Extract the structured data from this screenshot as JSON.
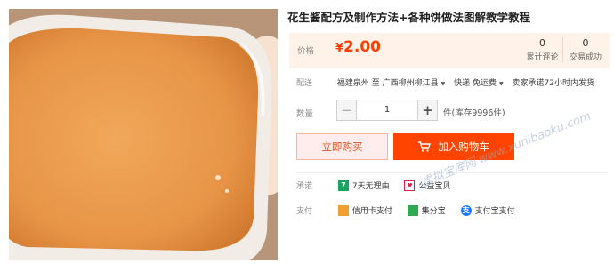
{
  "product": {
    "title": "花生酱配方及制作方法+各种饼做法图解教学教程",
    "image_alt": "peanut butter in a container"
  },
  "price": {
    "label": "价格",
    "currency": "¥",
    "amount": "2.00"
  },
  "stats": [
    {
      "count": "0",
      "label": "累计评论"
    },
    {
      "count": "0",
      "label": "交易成功"
    }
  ],
  "delivery": {
    "label": "配送",
    "from": "福建泉州",
    "to_word": "至",
    "destination": "广西柳州柳江县",
    "method": "快递 免运费",
    "promise": "卖家承诺72小时内发货"
  },
  "quantity": {
    "label": "数量",
    "minus": "−",
    "value": "1",
    "plus": "+",
    "stock": "件(库存9996件)"
  },
  "actions": {
    "buy_now": "立即购买",
    "add_to_cart": "加入购物车"
  },
  "service": {
    "label": "承诺",
    "items": [
      {
        "icon": "seven-day-return-icon",
        "glyph": "7",
        "text": "7天无理由"
      },
      {
        "icon": "charity-icon",
        "glyph": "♥",
        "text": "公益宝贝"
      }
    ]
  },
  "payment": {
    "label": "支付",
    "items": [
      {
        "icon": "credit-card-icon",
        "glyph": "",
        "text": "信用卡支付"
      },
      {
        "icon": "jifenbao-icon",
        "glyph": "",
        "text": "集分宝"
      },
      {
        "icon": "alipay-icon",
        "glyph": "支",
        "text": "支付宝支付"
      }
    ]
  },
  "watermark": "虚拟宝库网 www.xunibaoku.com",
  "colors": {
    "accent": "#ff4400",
    "price": "#ff3d00",
    "price_bg": "#fff2e8",
    "buy_bg": "#ffeded"
  }
}
